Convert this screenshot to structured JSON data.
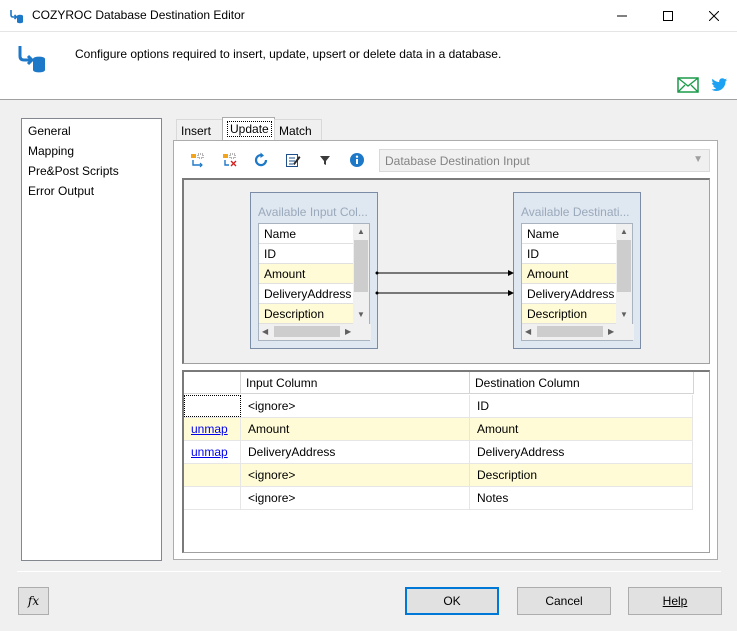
{
  "window": {
    "title": "COZYROC Database Destination Editor"
  },
  "header": {
    "description": "Configure options required to insert, update, upsert or delete data in a database."
  },
  "nav": {
    "items": [
      "General",
      "Mapping",
      "Pre&Post Scripts",
      "Error Output"
    ]
  },
  "tabs": [
    "Insert",
    "Update",
    "Match"
  ],
  "toolbar": {
    "destination_input": "Database Destination Input"
  },
  "input_columns": {
    "title": "Available Input Col...",
    "header": "Name",
    "rows": [
      "ID",
      "Amount",
      "DeliveryAddress",
      "Description"
    ]
  },
  "destination_columns": {
    "title": "Available Destinati...",
    "header": "Name",
    "rows": [
      "ID",
      "Amount",
      "DeliveryAddress",
      "Description"
    ]
  },
  "grid": {
    "headers": [
      "Input Column",
      "Destination Column"
    ],
    "rows": [
      {
        "action": "",
        "input": "<ignore>",
        "dest": "ID"
      },
      {
        "action": "unmap",
        "input": "Amount",
        "dest": "Amount"
      },
      {
        "action": "unmap",
        "input": "DeliveryAddress",
        "dest": "DeliveryAddress"
      },
      {
        "action": "",
        "input": "<ignore>",
        "dest": "Description"
      },
      {
        "action": "",
        "input": "<ignore>",
        "dest": "Notes"
      }
    ]
  },
  "buttons": {
    "fx": "fx",
    "ok": "OK",
    "cancel": "Cancel",
    "help": "Help"
  },
  "colors": {
    "accent": "#0078d7",
    "highlight": "#fefbd6",
    "link": "#0000ee"
  }
}
